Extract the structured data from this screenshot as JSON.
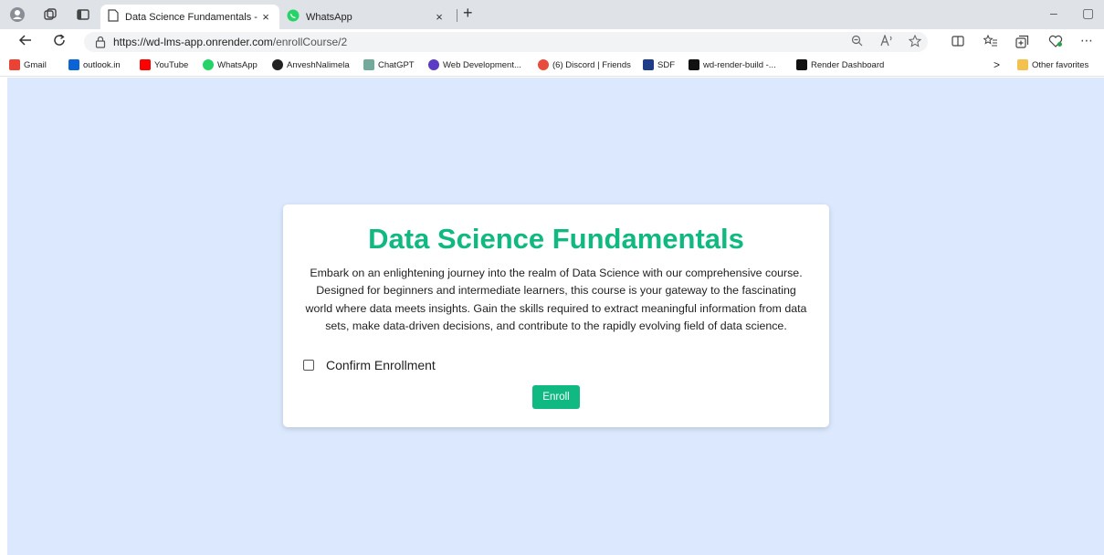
{
  "browser": {
    "tabs": [
      {
        "title": "Data Science Fundamentals - Enr",
        "active": true
      },
      {
        "title": "WhatsApp",
        "active": false
      }
    ],
    "tab_close": "×",
    "new_tab": "+",
    "minimize": "–",
    "restore": "▢",
    "url_scheme_host": "https://wd-lms-app.onrender.com",
    "url_path": "/enrollCourse/2"
  },
  "bookmarks": {
    "items": [
      {
        "label": "Gmail",
        "icon": "gmail-icon",
        "color": "#ea4335"
      },
      {
        "label": "outlook.in",
        "icon": "outlook-icon",
        "color": "#0a64d6"
      },
      {
        "label": "YouTube",
        "icon": "youtube-icon",
        "color": "#ff0000"
      },
      {
        "label": "WhatsApp",
        "icon": "whatsapp-icon",
        "color": "#25d366"
      },
      {
        "label": "AnveshNalimela",
        "icon": "github-icon",
        "color": "#222222"
      },
      {
        "label": "ChatGPT",
        "icon": "chatgpt-icon",
        "color": "#74aa9c"
      },
      {
        "label": "Web Development...",
        "icon": "webdev-icon",
        "color": "#5b3cc4"
      },
      {
        "label": "(6) Discord | Friends",
        "icon": "discord-icon",
        "color": "#e74c3c"
      },
      {
        "label": "SDF",
        "icon": "sdf-icon",
        "color": "#1f3c88"
      },
      {
        "label": "wd-render-build -...",
        "icon": "render-icon",
        "color": "#111111"
      },
      {
        "label": "Render Dashboard",
        "icon": "render-icon",
        "color": "#111111"
      }
    ],
    "other_favorites": "Other favorites",
    "overflow": ">"
  },
  "course": {
    "title": "Data Science Fundamentals",
    "description": "Embark on an enlightening journey into the realm of Data Science with our comprehensive course. Designed for beginners and intermediate learners, this course is your gateway to the fascinating world where data meets insights. Gain the skills required to extract meaningful information from data sets, make data-driven decisions, and contribute to the rapidly evolving field of data science.",
    "confirm_label": "Confirm Enrollment",
    "enroll_label": "Enroll"
  },
  "colors": {
    "accent": "#10b981",
    "page_background": "#dbe8fd"
  }
}
